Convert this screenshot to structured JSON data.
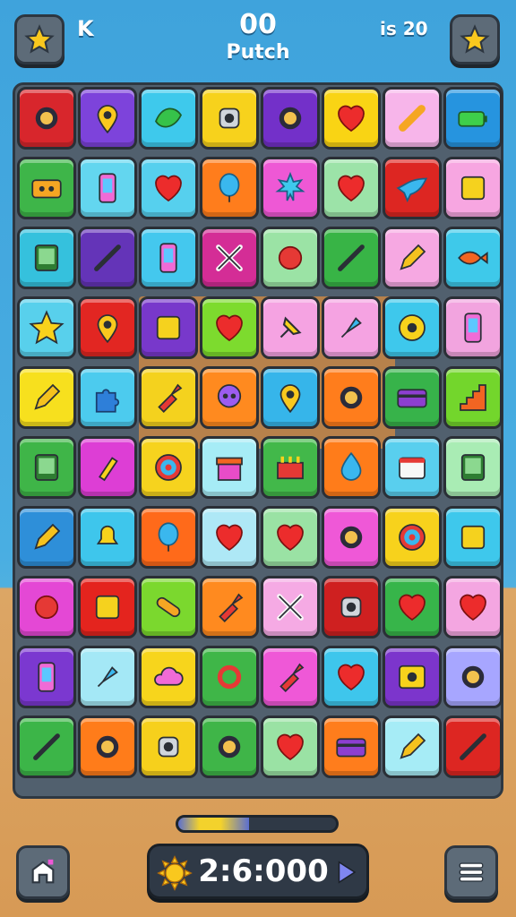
{
  "hud": {
    "left_label": "K",
    "score": "00",
    "title": "Putch",
    "right_label": "is 20"
  },
  "colors": {
    "tile_palette": [
      "#d62a2a",
      "#8a3fd9",
      "#38c7e6",
      "#f6d11d",
      "#7c2fbf",
      "#f7d31c",
      "#f5a8e3",
      "#1e9be0",
      "#3cb84a",
      "#44c9e6",
      "#ff7a1a",
      "#ef5cd6",
      "#9fe3a6",
      "#e8231f",
      "#f48fe3",
      "#9aa3ff"
    ]
  },
  "board": {
    "rows": [
      [
        {
          "bg": "#d8262c",
          "icon": "gear-icon"
        },
        {
          "bg": "#7d43db",
          "icon": "pin-icon"
        },
        {
          "bg": "#3ec9ec",
          "icon": "leaf-icon"
        },
        {
          "bg": "#f7d21c",
          "icon": "robot-icon"
        },
        {
          "bg": "#7330c9",
          "icon": "gear-icon"
        },
        {
          "bg": "#f9d414",
          "icon": "heart-icon"
        },
        {
          "bg": "#f7b5ea",
          "icon": "bone-icon"
        },
        {
          "bg": "#2694df",
          "icon": "battery-icon"
        }
      ],
      [
        {
          "bg": "#3eb549",
          "icon": "cassette-icon"
        },
        {
          "bg": "#63d6ef",
          "icon": "phone-icon"
        },
        {
          "bg": "#56d0ee",
          "icon": "heart-icon"
        },
        {
          "bg": "#ff7d1c",
          "icon": "balloon-icon"
        },
        {
          "bg": "#ee58d5",
          "icon": "maple-icon"
        },
        {
          "bg": "#9ce3a8",
          "icon": "heart-icon"
        },
        {
          "bg": "#dd2622",
          "icon": "bird-icon"
        },
        {
          "bg": "#f7a6e1",
          "icon": "square-icon"
        }
      ],
      [
        {
          "bg": "#35c1dd",
          "icon": "tablet-icon"
        },
        {
          "bg": "#6434b8",
          "icon": "slash-icon"
        },
        {
          "bg": "#44c8ee",
          "icon": "phone-icon"
        },
        {
          "bg": "#d42d96",
          "icon": "cross-icon"
        },
        {
          "bg": "#9be3a5",
          "icon": "ball-icon"
        },
        {
          "bg": "#38b446",
          "icon": "slash-icon"
        },
        {
          "bg": "#f6a8e2",
          "icon": "pencil-icon"
        },
        {
          "bg": "#3ec9ea",
          "icon": "fish-icon"
        }
      ],
      [
        {
          "bg": "#58d0ec",
          "icon": "star-icon"
        },
        {
          "bg": "#e22622",
          "icon": "pin-icon"
        },
        {
          "bg": "#7838cb",
          "icon": "square-icon"
        },
        {
          "bg": "#7ddb2e",
          "icon": "heart-icon"
        },
        {
          "bg": "#f5a3e2",
          "icon": "pushpin-icon"
        },
        {
          "bg": "#f5a3e2",
          "icon": "rocket-icon"
        },
        {
          "bg": "#3ec8ec",
          "icon": "wheel-icon"
        },
        {
          "bg": "#f2a4df",
          "icon": "phone-icon"
        }
      ],
      [
        {
          "bg": "#f7e01e",
          "icon": "pencil-icon"
        },
        {
          "bg": "#4ccbee",
          "icon": "puzzle-icon"
        },
        {
          "bg": "#f4d21e",
          "icon": "paintbrush-icon"
        },
        {
          "bg": "#ff8a1f",
          "icon": "skull-icon"
        },
        {
          "bg": "#36b5ea",
          "icon": "pin-icon"
        },
        {
          "bg": "#ff7d1c",
          "icon": "gear-icon"
        },
        {
          "bg": "#37b34a",
          "icon": "card-icon"
        },
        {
          "bg": "#73d62c",
          "icon": "stairs-icon"
        }
      ],
      [
        {
          "bg": "#3fb548",
          "icon": "tablet-icon"
        },
        {
          "bg": "#dd3ed5",
          "icon": "glue-icon"
        },
        {
          "bg": "#f6d31e",
          "icon": "target-icon"
        },
        {
          "bg": "#a6ecf6",
          "icon": "gift-icon"
        },
        {
          "bg": "#42b84a",
          "icon": "basket-icon"
        },
        {
          "bg": "#ff7c1a",
          "icon": "drop-icon"
        },
        {
          "bg": "#59cfee",
          "icon": "calendar-icon"
        },
        {
          "bg": "#a9ecb4",
          "icon": "tablet-icon"
        }
      ],
      [
        {
          "bg": "#2e8fd9",
          "icon": "pencil-icon"
        },
        {
          "bg": "#3ec6ec",
          "icon": "bell-icon"
        },
        {
          "bg": "#ff6a1a",
          "icon": "balloon-icon"
        },
        {
          "bg": "#aee8f6",
          "icon": "heart-icon"
        },
        {
          "bg": "#9ae2a4",
          "icon": "heart-icon"
        },
        {
          "bg": "#ef58d7",
          "icon": "gear-icon"
        },
        {
          "bg": "#f7d21c",
          "icon": "target-icon"
        },
        {
          "bg": "#3ec8ec",
          "icon": "square-icon"
        }
      ],
      [
        {
          "bg": "#e448d5",
          "icon": "ball-icon"
        },
        {
          "bg": "#e4241e",
          "icon": "square-icon"
        },
        {
          "bg": "#7bd82e",
          "icon": "bandage-icon"
        },
        {
          "bg": "#ff8a1f",
          "icon": "paintbrush-icon"
        },
        {
          "bg": "#f5aae4",
          "icon": "cross-icon"
        },
        {
          "bg": "#cf2020",
          "icon": "robot-icon"
        },
        {
          "bg": "#37b54a",
          "icon": "heart-icon"
        },
        {
          "bg": "#f4a6e1",
          "icon": "heart-icon"
        }
      ],
      [
        {
          "bg": "#7b38d0",
          "icon": "phone-icon"
        },
        {
          "bg": "#a4e8f6",
          "icon": "rocket-icon"
        },
        {
          "bg": "#f7d51c",
          "icon": "cloud-icon"
        },
        {
          "bg": "#3fb648",
          "icon": "ring-icon"
        },
        {
          "bg": "#ef58d7",
          "icon": "paintbrush-icon"
        },
        {
          "bg": "#3ec6ec",
          "icon": "heart-icon"
        },
        {
          "bg": "#7c35cc",
          "icon": "radio-icon"
        },
        {
          "bg": "#a7a6ff",
          "icon": "gear-icon"
        }
      ],
      [
        {
          "bg": "#3cb548",
          "icon": "slash-icon"
        },
        {
          "bg": "#ff7c1a",
          "icon": "gear-icon"
        },
        {
          "bg": "#f6d01c",
          "icon": "robot-icon"
        },
        {
          "bg": "#3fb548",
          "icon": "gear-icon"
        },
        {
          "bg": "#9ae2a4",
          "icon": "heart-icon"
        },
        {
          "bg": "#ff7d1c",
          "icon": "card-icon"
        },
        {
          "bg": "#a6ecf6",
          "icon": "pencil-icon"
        },
        {
          "bg": "#dd2622",
          "icon": "slash-icon"
        }
      ]
    ]
  },
  "progress": {
    "value": 0.45
  },
  "timer": {
    "text": "2:6:000"
  }
}
